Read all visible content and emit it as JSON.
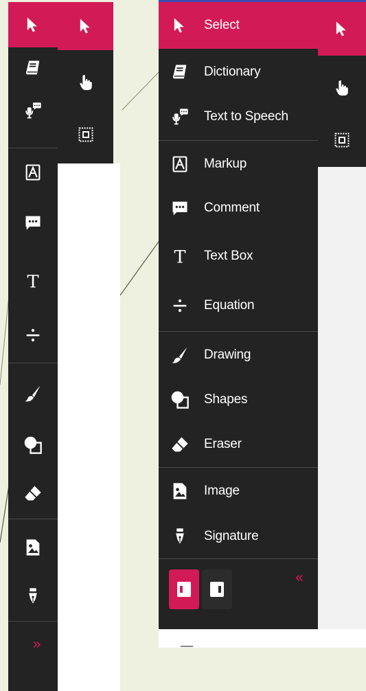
{
  "collapsed_toolbar": {
    "items": [
      {
        "name": "select",
        "icon": "cursor-arrow-icon"
      },
      {
        "name": "dictionary",
        "icon": "book-icon"
      },
      {
        "name": "text-to-speech",
        "icon": "speaker-icon"
      },
      {
        "name": "markup",
        "icon": "highlighter-icon"
      },
      {
        "name": "comment",
        "icon": "comment-bubble-icon"
      },
      {
        "name": "text-box",
        "icon": "text-t-icon"
      },
      {
        "name": "equation",
        "icon": "divide-icon"
      },
      {
        "name": "drawing",
        "icon": "brush-icon"
      },
      {
        "name": "shapes",
        "icon": "shapes-icon"
      },
      {
        "name": "eraser",
        "icon": "eraser-icon"
      },
      {
        "name": "image",
        "icon": "image-icon"
      },
      {
        "name": "signature",
        "icon": "fountain-pen-icon"
      }
    ],
    "expand_chevron": "»"
  },
  "side_strip": {
    "items": [
      {
        "name": "select",
        "icon": "cursor-arrow-icon"
      },
      {
        "name": "pan",
        "icon": "hand-pointer-icon"
      },
      {
        "name": "area-select",
        "icon": "marquee-select-icon"
      }
    ]
  },
  "expanded_toolbar": {
    "items": [
      {
        "label": "Select",
        "icon": "cursor-arrow-icon"
      },
      {
        "label": "Dictionary",
        "icon": "book-icon"
      },
      {
        "label": "Text to Speech",
        "icon": "speaker-icon"
      },
      {
        "label": "Markup",
        "icon": "highlighter-icon"
      },
      {
        "label": "Comment",
        "icon": "comment-bubble-icon"
      },
      {
        "label": "Text Box",
        "icon": "text-t-icon"
      },
      {
        "label": "Equation",
        "icon": "divide-icon"
      },
      {
        "label": "Drawing",
        "icon": "brush-icon"
      },
      {
        "label": "Shapes",
        "icon": "shapes-icon"
      },
      {
        "label": "Eraser",
        "icon": "eraser-icon"
      },
      {
        "label": "Image",
        "icon": "image-icon"
      },
      {
        "label": "Signature",
        "icon": "fountain-pen-icon"
      }
    ],
    "collapse_chevron": "«"
  },
  "colors": {
    "accent": "#d21a56",
    "panel": "#232323",
    "separator": "#4a4a4a",
    "background": "#eef1df"
  }
}
